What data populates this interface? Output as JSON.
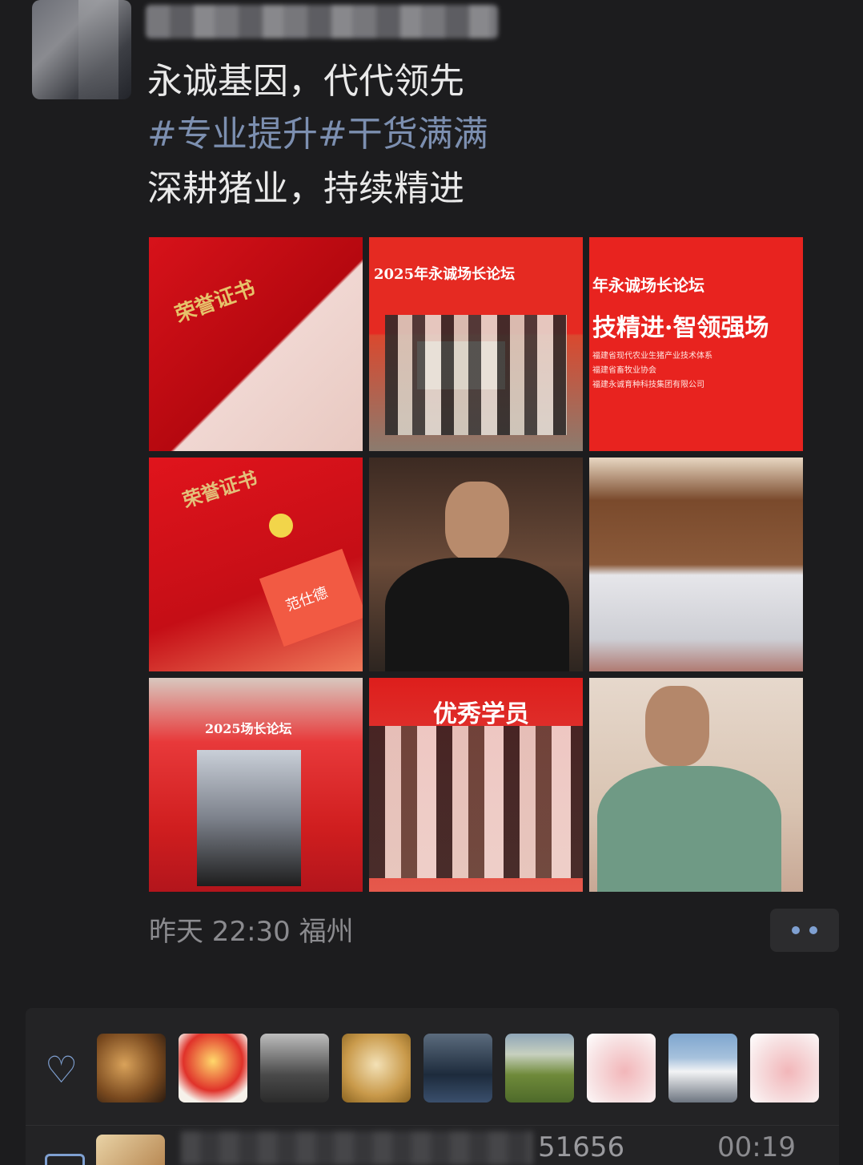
{
  "post": {
    "text_line_1": "永诚基因，代代领先",
    "hashtags": "#专业提升#干货满满",
    "text_line_3": "深耕猪业，持续精进",
    "time": "昨天 22:30",
    "location": "福州"
  },
  "photos": {
    "p1_caption": "荣誉证书",
    "p2_caption": "2025年永诚场长论坛",
    "p3_caption_1": "年永诚场长论坛",
    "p3_caption_2": "技精进·智领强场",
    "p3_small": "福建省现代农业生猪产业技术体系\n福建省畜牧业协会\n福建永诚育种科技集团有限公司",
    "p4_caption": "荣誉证书",
    "p4_card": "范仕德",
    "p7_caption": "2025场长论坛",
    "p8_caption": "优秀学员"
  },
  "likes": {
    "icon": "heart-outline-icon",
    "avatars": [
      "avatar-1",
      "avatar-2",
      "avatar-3",
      "avatar-4",
      "avatar-5",
      "avatar-6",
      "avatar-7",
      "avatar-8",
      "avatar-9"
    ]
  },
  "comment": {
    "visible_text": "51656",
    "time": "00:19"
  },
  "colors": {
    "background": "#1c1c1e",
    "link": "#7c8fb0",
    "accent": "#7fa0d1"
  }
}
